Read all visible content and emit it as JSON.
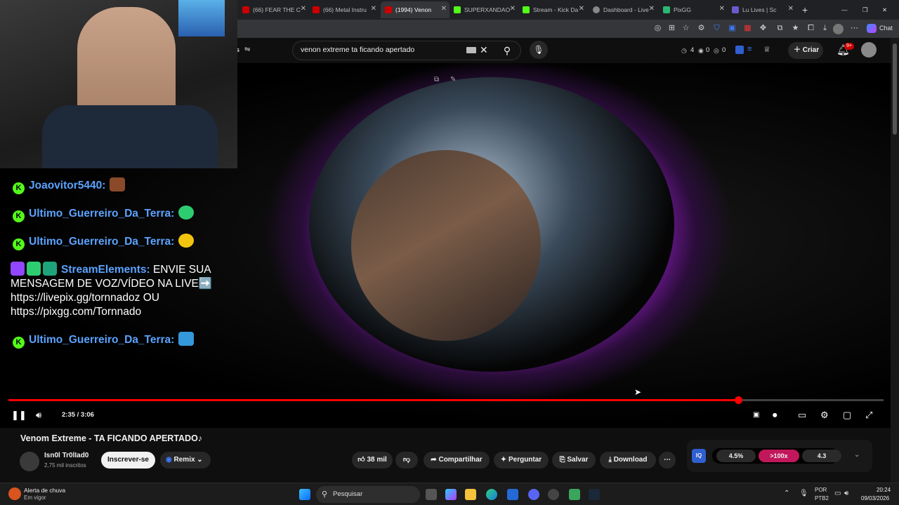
{
  "tabs": [
    {
      "label": "(66) FEAR THE C",
      "color": "#c00"
    },
    {
      "label": "(66) Metal Instru",
      "color": "#c00"
    },
    {
      "label": "(1994) Venon",
      "color": "#c00"
    },
    {
      "label": "SUPERXANDAO",
      "color": "#53fc18"
    },
    {
      "label": "Stream - Kick Da",
      "color": "#53fc18"
    },
    {
      "label": "Dashboard - Live",
      "color": "#888"
    },
    {
      "label": "PixGG",
      "color": "#2bb673"
    },
    {
      "label": "Lu Lives | Sc",
      "color": "#6a5acd"
    }
  ],
  "toolbar": {
    "chat_label": "Chat"
  },
  "header": {
    "left_fragment": "s",
    "search_value": "venon extreme ta ficando apertado",
    "stats": [
      "4",
      "0",
      "0"
    ],
    "create_label": "Criar",
    "notif_count": "9+"
  },
  "chat": {
    "lines": [
      {
        "user": "Joaovitor5440:",
        "text": "",
        "emote": "#8a4a2a"
      },
      {
        "user": "Ultimo_Guerreiro_Da_Terra:",
        "text": "",
        "emote": "#2ecc71"
      },
      {
        "user": "Ultimo_Guerreiro_Da_Terra:",
        "text": "",
        "emote": "#f1c40f"
      },
      {
        "user": "StreamElements:",
        "text": "ENVIE SUA MENSAGEM DE VOZ/VÍDEO NA LIVE➡️ https://livepix.gg/tornnadoz OU https://pixgg.com/Tornnado"
      },
      {
        "user": "Ultimo_Guerreiro_Da_Terra:",
        "text": "",
        "emote": "#3498db"
      }
    ]
  },
  "player": {
    "time": "2:35 / 3:06",
    "progress": 0.834
  },
  "video": {
    "title": "Venom Extreme - TA FICANDO APERTADO♪",
    "channel": "Isn0l Tr0lIad0",
    "subscribers": "2,75 mil inscritos",
    "subscribe_label": "Inscrever-se",
    "remix_label": "Remix",
    "likes": "38 mil",
    "share_label": "Compartilhar",
    "ask_label": "Perguntar",
    "save_label": "Salvar",
    "download_label": "Download",
    "ext_stats": [
      "4.5%",
      ">100x",
      "4.3"
    ]
  },
  "taskbar": {
    "weather_title": "Alerta de chuva",
    "weather_sub": "Em vigor",
    "search_label": "Pesquisar",
    "lang1": "POR",
    "lang2": "PTB2",
    "time": "20:24",
    "date": "09/03/2026"
  }
}
